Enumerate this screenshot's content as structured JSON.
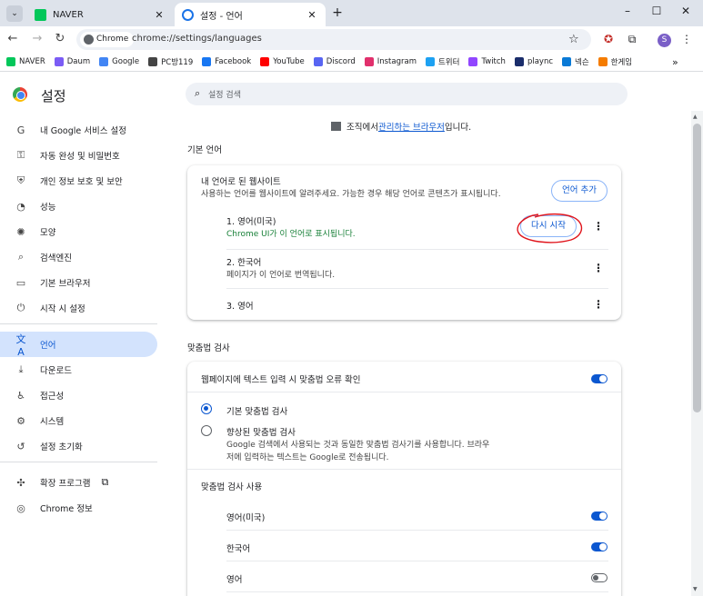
{
  "tabs": [
    {
      "title": "NAVER"
    },
    {
      "title": "설정 - 언어"
    }
  ],
  "address": {
    "chip": "Chrome",
    "url": "chrome://settings/languages"
  },
  "profile_initial": "S",
  "bookmarks": [
    {
      "label": "NAVER",
      "color": "#03c75a"
    },
    {
      "label": "Daum",
      "color": "#7b5cf5"
    },
    {
      "label": "Google",
      "color": "#4285f4"
    },
    {
      "label": "PC방119",
      "color": "#444444"
    },
    {
      "label": "Facebook",
      "color": "#1877f2"
    },
    {
      "label": "YouTube",
      "color": "#ff0000"
    },
    {
      "label": "Discord",
      "color": "#5865f2"
    },
    {
      "label": "Instagram",
      "color": "#e1306c"
    },
    {
      "label": "트위터",
      "color": "#1da1f2"
    },
    {
      "label": "Twitch",
      "color": "#9146ff"
    },
    {
      "label": "plaync",
      "color": "#1a2d6b"
    },
    {
      "label": "넥슨",
      "color": "#0a7ad6"
    },
    {
      "label": "한게임",
      "color": "#f57c00"
    }
  ],
  "settings": {
    "title": "설정",
    "search_placeholder": "설정 검색",
    "sidebar": [
      {
        "label": "내 Google 서비스 설정",
        "icon": "G"
      },
      {
        "label": "자동 완성 및 비밀번호",
        "icon": "⚿"
      },
      {
        "label": "개인 정보 보호 및 보안",
        "icon": "⛨"
      },
      {
        "label": "성능",
        "icon": "◔"
      },
      {
        "label": "모양",
        "icon": "✺"
      },
      {
        "label": "검색엔진",
        "icon": "⌕"
      },
      {
        "label": "기본 브라우저",
        "icon": "▭"
      },
      {
        "label": "시작 시 설정",
        "icon": "⏻"
      },
      {
        "label": "언어",
        "icon": "文A"
      },
      {
        "label": "다운로드",
        "icon": "⤓"
      },
      {
        "label": "접근성",
        "icon": "♿"
      },
      {
        "label": "시스템",
        "icon": "⚙"
      },
      {
        "label": "설정 초기화",
        "icon": "↺"
      },
      {
        "label": "확장 프로그램",
        "icon": "✣"
      },
      {
        "label": "Chrome 정보",
        "icon": "◎"
      }
    ],
    "managed_prefix": "조직에서 ",
    "managed_link": "관리하는 브라우저",
    "managed_suffix": "입니다."
  },
  "languages": {
    "section_title": "기본 언어",
    "card_title": "내 언어로 된 웹사이트",
    "card_desc": "사용하는 언어를 웹사이트에 알려주세요. 가능한 경우 해당 언어로 콘텐츠가 표시됩니다.",
    "add_button": "언어 추가",
    "items": [
      {
        "name": "1. 영어(미국)",
        "sub": "Chrome UI가 이 언어로 표시됩니다."
      },
      {
        "name": "2. 한국어",
        "sub": "페이지가 이 언어로 번역됩니다."
      },
      {
        "name": "3. 영어",
        "sub": ""
      }
    ],
    "restart_button": "다시 시작"
  },
  "spellcheck": {
    "section_title": "맞춤법 검사",
    "toggle_label": "웹페이지에 텍스트 입력 시 맞춤법 오류 확인",
    "toggle_on": true,
    "basic_label": "기본 맞춤법 검사",
    "enhanced_label": "향상된 맞춤법 검사",
    "enhanced_desc_1": "Google 검색에서 사용되는 것과 동일한 맞춤법 검사기를 사용합니다. 브라우",
    "enhanced_desc_2": "저에 입력하는 텍스트는 Google로 전송됩니다.",
    "use_title": "맞춤법 검사 사용",
    "langs": [
      {
        "name": "영어(미국)",
        "on": true
      },
      {
        "name": "한국어",
        "on": true
      },
      {
        "name": "영어",
        "on": false
      }
    ]
  },
  "colors": {
    "accent": "#0b57d0",
    "annotation": "#e0141b"
  }
}
